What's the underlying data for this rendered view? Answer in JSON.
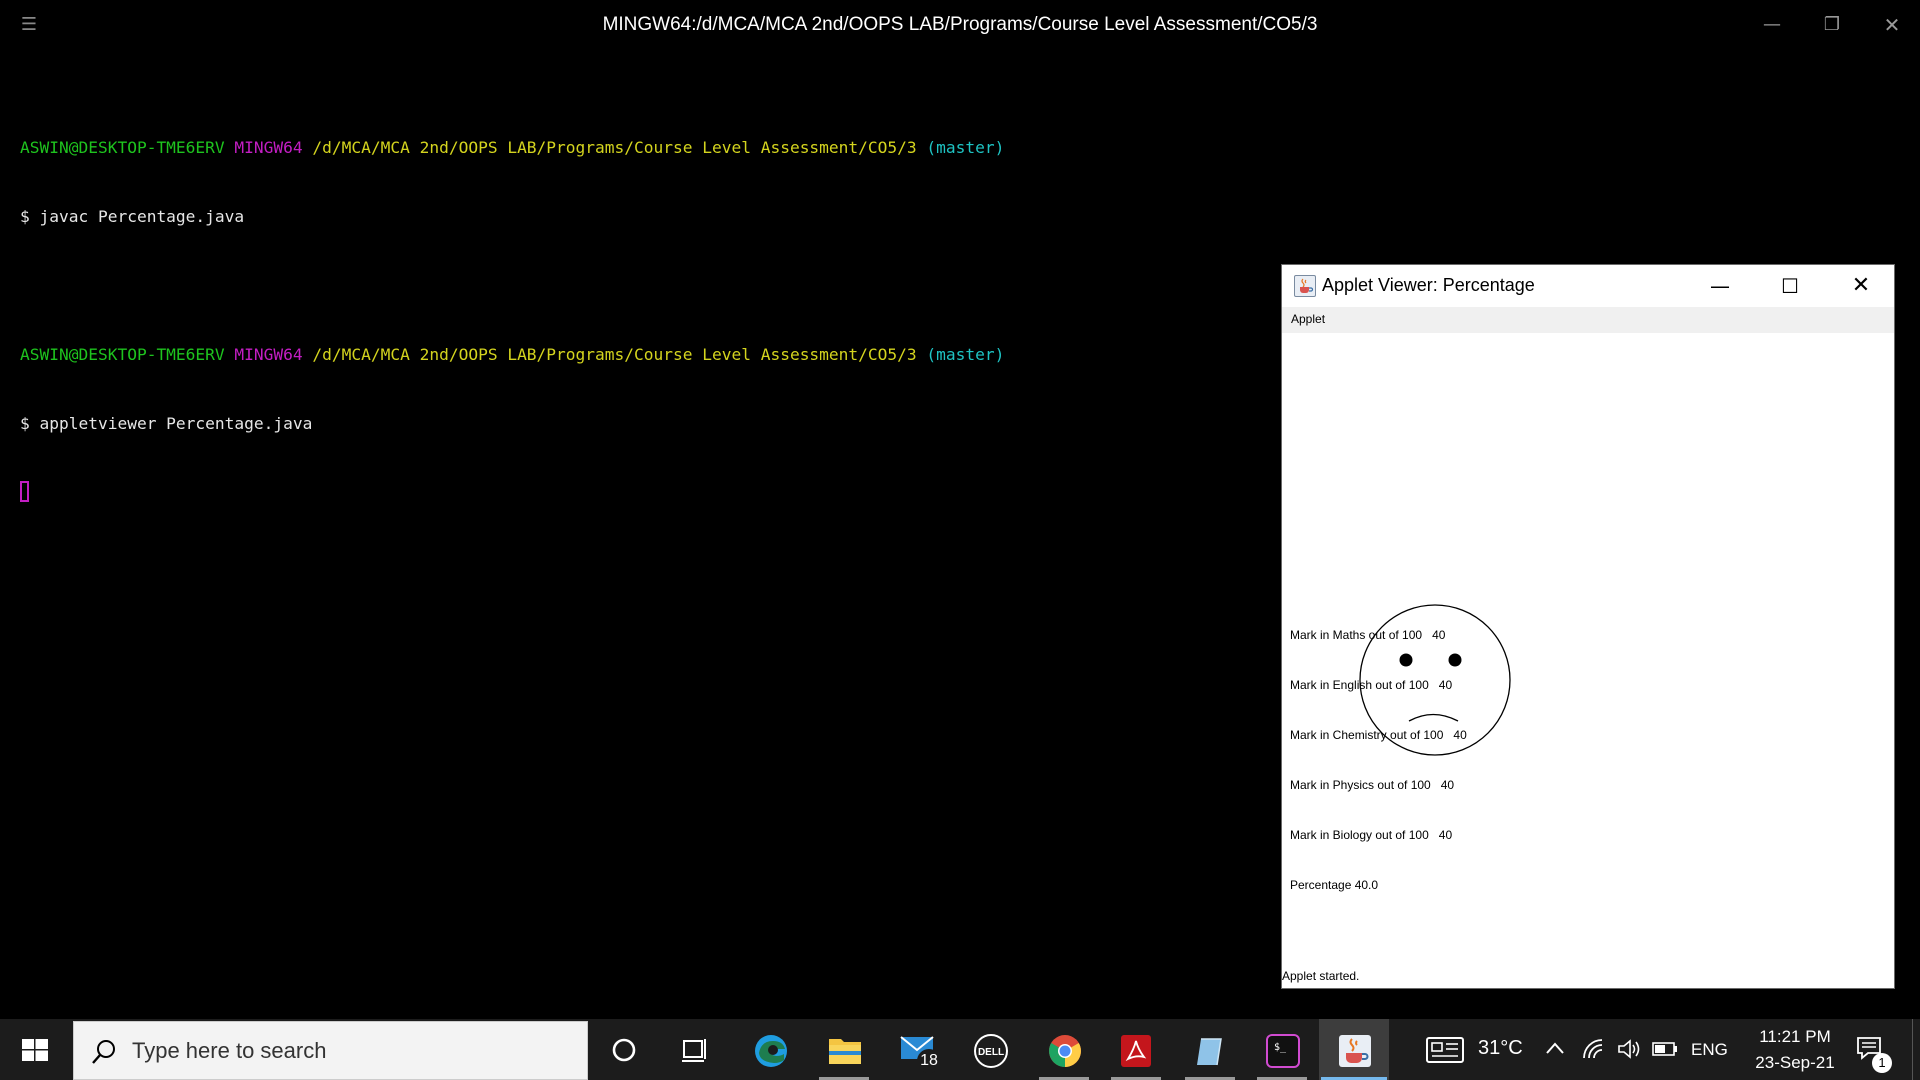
{
  "terminal": {
    "title": "MINGW64:/d/MCA/MCA 2nd/OOPS LAB/Programs/Course Level Assessment/CO5/3",
    "controls": {
      "menu": "☰",
      "minimize": "—",
      "maximize": "❐",
      "close": "✕"
    },
    "prompts": [
      {
        "user": "ASWIN@DESKTOP-TME6ERV",
        "shell": "MINGW64",
        "path": "/d/MCA/MCA 2nd/OOPS LAB/Programs/Course Level Assessment/CO5/3",
        "branch": "(master)",
        "command": "$ javac Percentage.java"
      },
      {
        "user": "ASWIN@DESKTOP-TME6ERV",
        "shell": "MINGW64",
        "path": "/d/MCA/MCA 2nd/OOPS LAB/Programs/Course Level Assessment/CO5/3",
        "branch": "(master)",
        "command": "$ appletviewer Percentage.java"
      }
    ],
    "colors": {
      "user": "#1ec31e",
      "shell": "#c31ec3",
      "path": "#d4d41e",
      "branch": "#1ec3c3"
    }
  },
  "applet": {
    "title": "Applet Viewer: Percentage",
    "menu": "Applet",
    "controls": {
      "minimize": "—",
      "maximize": "☐",
      "close": "✕"
    },
    "face": "sad",
    "marks": [
      {
        "label": "Mark in Maths out of 100",
        "value": "40"
      },
      {
        "label": "Mark in English out of 100",
        "value": "40"
      },
      {
        "label": "Mark in Chemistry out of 100",
        "value": "40"
      },
      {
        "label": "Mark in Physics out of 100",
        "value": "40"
      },
      {
        "label": "Mark in Biology out of 100",
        "value": "40"
      }
    ],
    "percentage": "Percentage 40.0",
    "status": "Applet started."
  },
  "taskbar": {
    "search_placeholder": "Type here to search",
    "icons": [
      "windows-start-icon",
      "cortana-icon",
      "task-view-icon",
      "edge-icon",
      "file-explorer-icon",
      "mail-icon",
      "dell-icon",
      "chrome-icon",
      "acrobat-icon",
      "notepad-icon",
      "terminal-icon",
      "java-icon"
    ],
    "mail_badge": "18",
    "weather_temp": "31°C",
    "language": "ENG",
    "time": "11:21 PM",
    "date": "23-Sep-21",
    "notification_count": "1",
    "accent": "#76b9ed"
  }
}
